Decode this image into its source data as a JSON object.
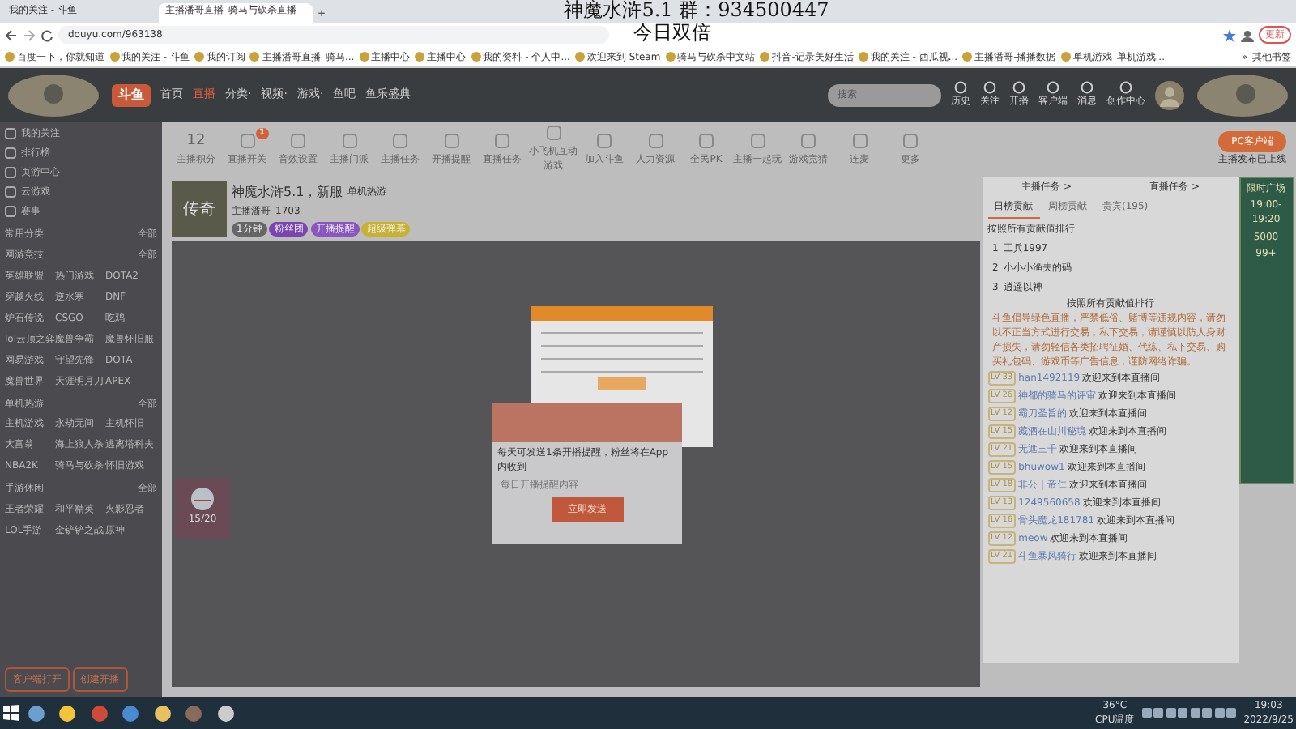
{
  "overlay": {
    "title": "神魔水浒5.1  群：934500447",
    "subtitle": "今日双倍"
  },
  "browser": {
    "tabs": [
      {
        "label": "我的关注 - 斗鱼",
        "selected": false
      },
      {
        "label": "主播潘哥直播_骑马与砍杀直播_",
        "selected": true
      }
    ],
    "new_tab": "+",
    "url": "douyu.com/963138",
    "update_button": "更新",
    "bookmarks": [
      "百度一下，你就知道",
      "我的关注 - 斗鱼",
      "我的订阅",
      "主播潘哥直播_骑马...",
      "主播中心",
      "主播中心",
      "我的资料 - 个人中...",
      "欢迎来到 Steam",
      "骑马与砍杀中文站",
      "抖音-记录美好生活",
      "我的关注 - 西瓜视...",
      "主播潘哥-播播数据",
      "单机游戏_单机游戏..."
    ],
    "more_bookmarks": "»",
    "other_bookmarks": "其他书签"
  },
  "site": {
    "logo": "斗鱼",
    "nav": [
      {
        "label": "首页",
        "selected": false
      },
      {
        "label": "直播",
        "selected": true
      },
      {
        "label": "分类·",
        "selected": false
      },
      {
        "label": "视频·",
        "selected": false
      },
      {
        "label": "游戏·",
        "selected": false
      },
      {
        "label": "鱼吧",
        "selected": false
      },
      {
        "label": "鱼乐盛典",
        "selected": false
      }
    ],
    "search": {
      "placeholder": "搜索"
    },
    "actions": [
      "历史",
      "关注",
      "开播",
      "客户端",
      "消息",
      "创作中心"
    ]
  },
  "sidebar": {
    "items": [
      "我的关注",
      "排行榜",
      "页游中心",
      "云游戏",
      "赛事"
    ],
    "sections": [
      {
        "title": "常用分类",
        "more": "全部"
      },
      {
        "title": "网游竞技",
        "more": "全部",
        "games": [
          "英雄联盟",
          "热门游戏",
          "DOTA2",
          "穿越火线",
          "逆水寒",
          "DNF",
          "炉石传说",
          "CSGO",
          "吃鸡",
          "lol云顶之弈",
          "魔兽争霸",
          "魔兽怀旧服",
          "网易游戏",
          "守望先锋",
          "DOTA",
          "魔兽世界",
          "天涯明月刀",
          "APEX"
        ]
      },
      {
        "title": "单机热游",
        "more": "全部",
        "games": [
          "主机游戏",
          "永劫无间",
          "主机怀旧",
          "大富翁",
          "海上狼人杀",
          "逃离塔科夫",
          "NBA2K",
          "骑马与砍杀",
          "怀旧游戏"
        ]
      },
      {
        "title": "手游休闲",
        "more": "全部",
        "games": [
          "王者荣耀",
          "和平精英",
          "火影忍者",
          "LOL手游",
          "金铲铲之战",
          "原神"
        ]
      }
    ],
    "buttons": [
      "客户端打开",
      "创建开播"
    ]
  },
  "toolbar": {
    "score": "12",
    "score_label": "主播积分",
    "badge": "1",
    "tools": [
      "直播开关",
      "音效设置",
      "主播门派",
      "主播任务",
      "开播提醒",
      "直播任务",
      "小飞机互动游戏",
      "加入斗鱼",
      "人力资源",
      "全民PK",
      "主播一起玩",
      "游戏竞猜",
      "连麦",
      "更多"
    ],
    "pc_button": "PC客户端",
    "pc_note": "主播发布已上线"
  },
  "room": {
    "cover_text": "传奇",
    "title": "神魔水浒5.1，新服",
    "category": "单机热游",
    "anchor": "主播潘哥",
    "hot": "1703",
    "tags": [
      "1分钟",
      "粉丝团 ",
      "开播提醒",
      "超级弹幕"
    ]
  },
  "player": {
    "gift_count": "15/20",
    "reminder": {
      "message": "每天可发送1条开播提醒，粉丝将在App内收到",
      "placeholder": "每日开播提醒内容",
      "button": "立即发送"
    }
  },
  "right_panel": {
    "links": [
      "主播任务 >",
      "直播任务 >"
    ],
    "tabs": [
      {
        "label": "日榜贡献",
        "selected": true
      },
      {
        "label": "周榜贡献",
        "selected": false
      },
      {
        "label": "贵宾(195)",
        "selected": false
      }
    ],
    "rank_note": "按照所有贡献值排行",
    "ranking": [
      {
        "rank": "1",
        "name": "工兵1997"
      },
      {
        "rank": "2",
        "name": "小小小渔夫的码"
      },
      {
        "rank": "3",
        "name": "逍遥以神"
      }
    ],
    "notice_title": "按照所有贡献值排行",
    "notice": "斗鱼倡导绿色直播，严禁低俗、赌博等违规内容，请勿以不正当方式进行交易，私下交易，请谨慎以防人身财产损失，请勿轻信各类招聘征婚、代练、私下交易、购买礼包码、游戏币等广告信息，谨防网络诈骗。",
    "chat": [
      {
        "level": "LV 33",
        "user": "han1492119",
        "text": "欢迎来到本直播间"
      },
      {
        "level": "LV 26",
        "user": "神都的骑马的评审",
        "text": "欢迎来到本直播间"
      },
      {
        "level": "LV 12",
        "user": "霸刀圣旨的",
        "text": "欢迎来到本直播间"
      },
      {
        "level": "LV 15",
        "user": "藏酒在山川秘境",
        "text": "欢迎来到本直播间"
      },
      {
        "level": "LV 21",
        "user": "无遮三千",
        "text": "欢迎来到本直播间"
      },
      {
        "level": "LV 15",
        "user": "bhuwow1",
        "text": "欢迎来到本直播间"
      },
      {
        "level": "LV 18",
        "user": "非公｜帝仁",
        "text": "欢迎来到本直播间"
      },
      {
        "level": "LV 13",
        "user": "1249560658",
        "text": "欢迎来到本直播间"
      },
      {
        "level": "LV 16",
        "user": "骨头魔龙181781",
        "text": "欢迎来到本直播间"
      },
      {
        "level": "LV 12",
        "user": "meow",
        "text": "欢迎来到本直播间"
      },
      {
        "level": "LV 21",
        "user": "斗鱼暴风骑行",
        "text": "欢迎来到本直播间"
      }
    ],
    "ad": [
      "限时广场",
      "19:00-19:20",
      "5000",
      "99+"
    ]
  },
  "taskbar": {
    "temperature": "36°C",
    "temperature_label": "CPU温度",
    "time": "19:03",
    "date": "2022/9/25"
  }
}
